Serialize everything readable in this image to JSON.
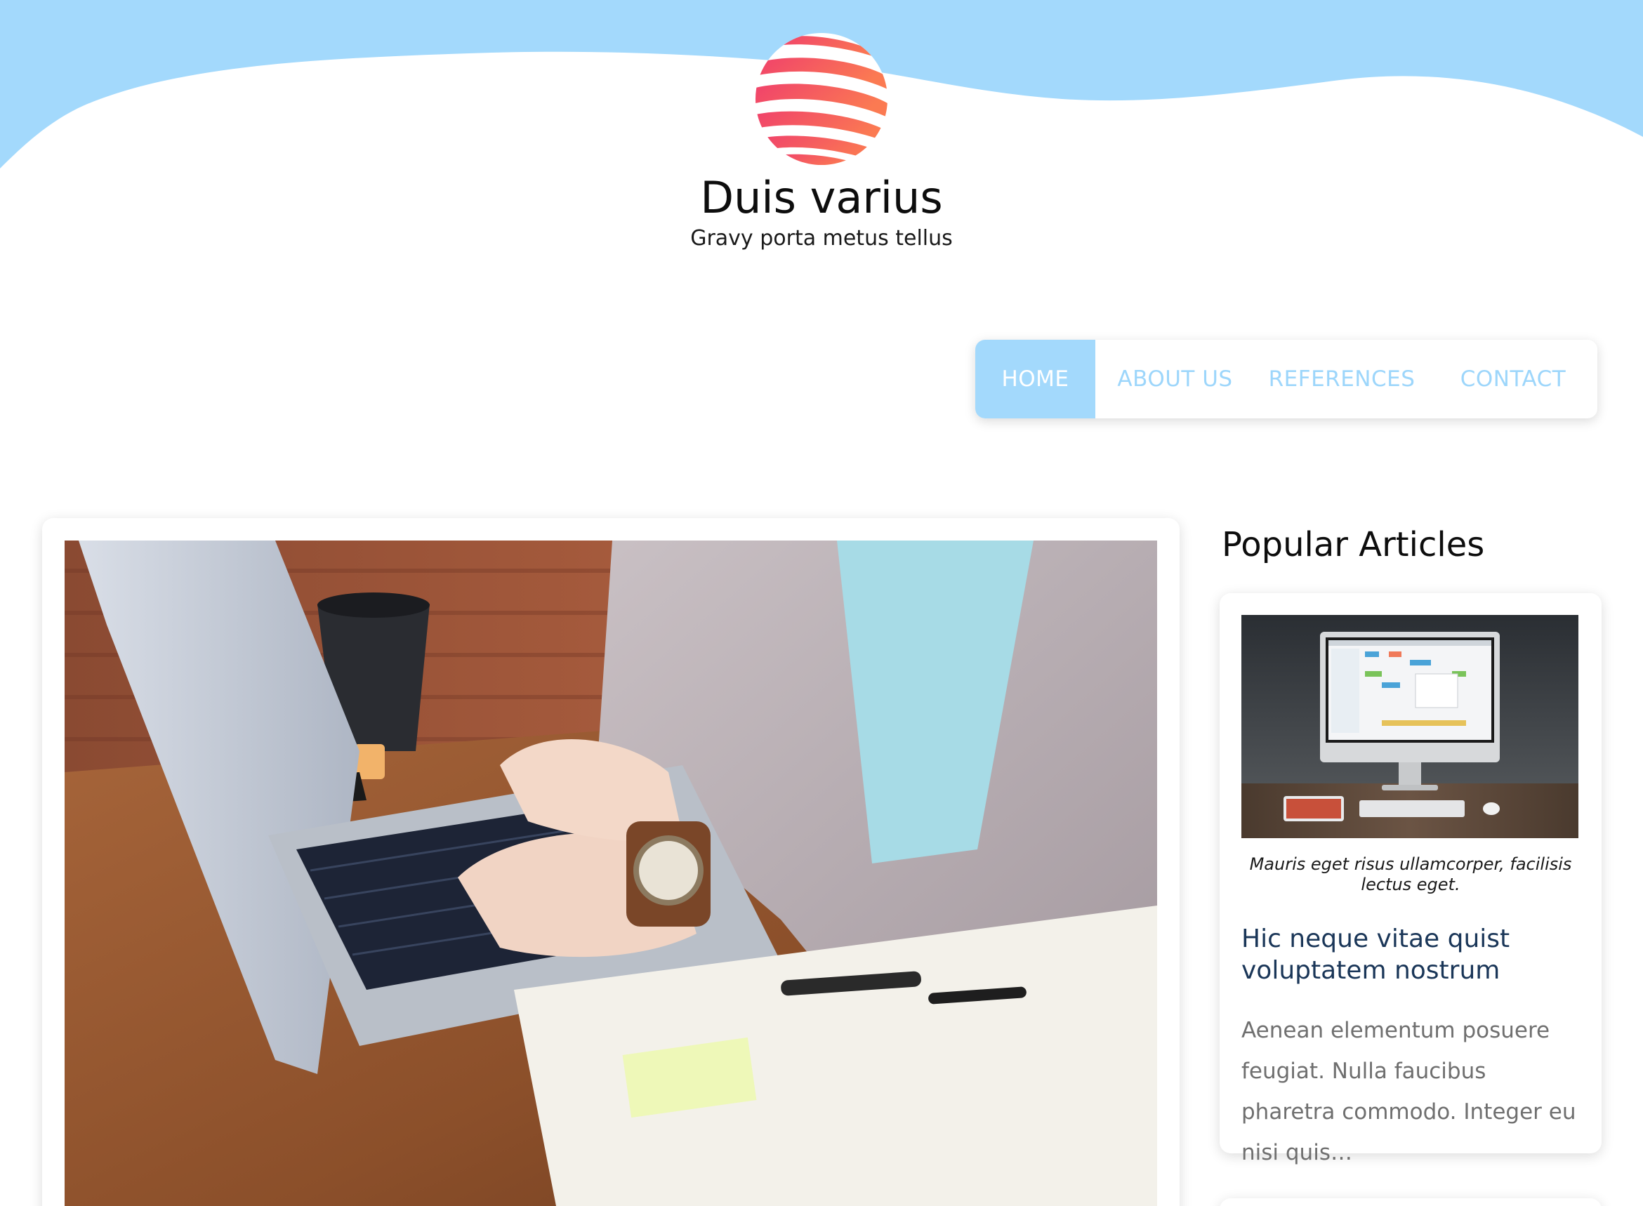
{
  "site": {
    "title": "Duis varius",
    "tagline": "Gravy porta metus tellus"
  },
  "colors": {
    "accent": "#a3d9fc",
    "nav_text": "#9dd6fb",
    "article_title": "#1a3658",
    "logo_gradient": [
      "#f0426b",
      "#fb7a52"
    ]
  },
  "nav": {
    "items": [
      {
        "label": "HOME",
        "active": true
      },
      {
        "label": "ABOUT US",
        "active": false
      },
      {
        "label": "REFERENCES",
        "active": false
      },
      {
        "label": "CONTACT",
        "active": false
      }
    ]
  },
  "main": {
    "hero_image": "person-typing-on-laptop-photo"
  },
  "sidebar": {
    "heading": "Popular Articles",
    "articles": [
      {
        "image": "desktop-computer-photo",
        "caption": "Mauris eget risus ullamcorper, facilisis lectus eget.",
        "title": "Hic neque vitae quist voluptatem nostrum",
        "excerpt": "Aenean elementum posuere feugiat. Nulla faucibus pharetra commodo. Integer eu nisi quis…"
      }
    ]
  }
}
